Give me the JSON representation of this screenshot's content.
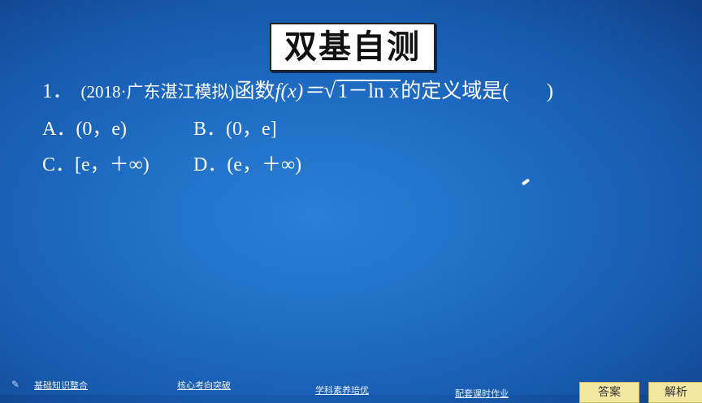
{
  "slide": {
    "title": "双基自测",
    "question": {
      "number": "1．",
      "source": "(2018·广东湛江模拟)",
      "text_before": "函数",
      "func": "f(x)＝",
      "radicand": "1－ln x",
      "text_after": "的定义域是(",
      "paren_close": ")"
    },
    "options": [
      {
        "label": "A．(0，e)"
      },
      {
        "label": "B．(0，e]"
      },
      {
        "label": "C．[e，＋∞)"
      },
      {
        "label": "D．(e，＋∞)"
      }
    ]
  },
  "navbar": {
    "items": [
      "基础知识整合",
      "核心考向突破",
      "学科素养培优",
      "配套课时作业"
    ]
  },
  "buttons": {
    "answer": "答案",
    "explain": "解析"
  },
  "icons": {
    "pen": "pen-icon",
    "cursor": "pointer-cursor"
  }
}
